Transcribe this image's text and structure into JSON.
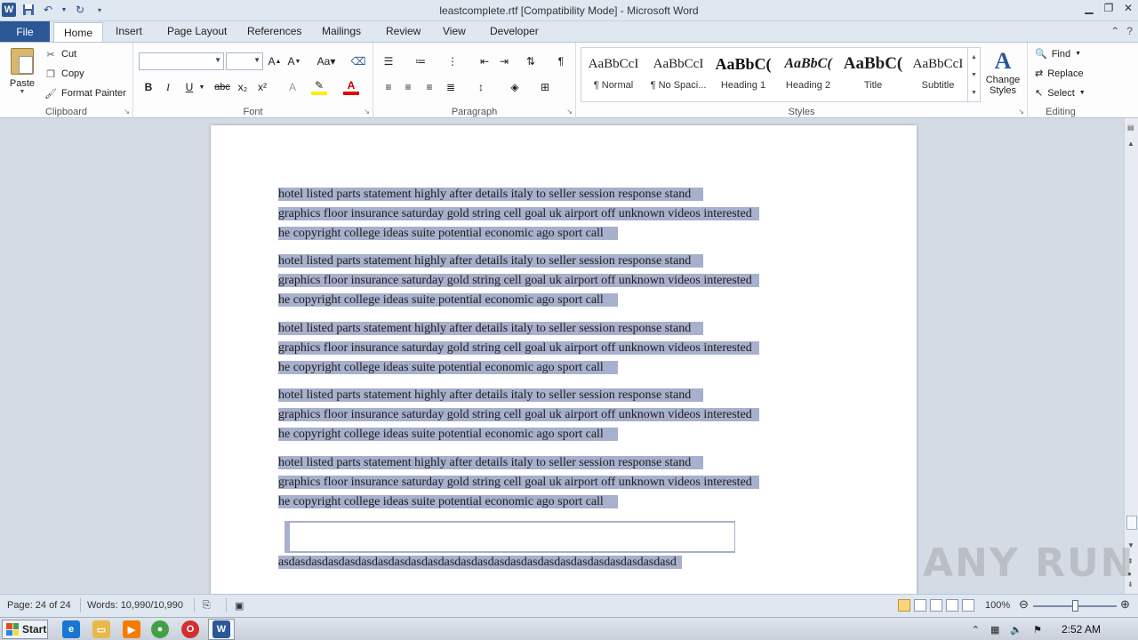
{
  "window": {
    "title": "leastcomplete.rtf [Compatibility Mode]  -  Microsoft Word"
  },
  "tabs": [
    "File",
    "Home",
    "Insert",
    "Page Layout",
    "References",
    "Mailings",
    "Review",
    "View",
    "Developer"
  ],
  "clipboard": {
    "paste": "Paste",
    "cut": "Cut",
    "copy": "Copy",
    "format_painter": "Format Painter",
    "group_label": "Clipboard"
  },
  "font": {
    "family_value": "",
    "size_value": "",
    "group_label": "Font",
    "bold": "B",
    "italic": "I",
    "underline": "U",
    "strikethrough": "abc",
    "subscript": "x₂",
    "superscript": "x²"
  },
  "paragraph": {
    "group_label": "Paragraph"
  },
  "styles": {
    "group_label": "Styles",
    "items": [
      {
        "preview": "AaBbCcI",
        "name": "¶ Normal"
      },
      {
        "preview": "AaBbCcI",
        "name": "¶ No Spaci..."
      },
      {
        "preview": "AaBbC(",
        "name": "Heading 1"
      },
      {
        "preview": "AaBbC(",
        "name": "Heading 2"
      },
      {
        "preview": "AaBbC(",
        "name": "Title"
      },
      {
        "preview": "AaBbCcI",
        "name": "Subtitle"
      }
    ],
    "change_styles": "Change Styles"
  },
  "editing": {
    "group_label": "Editing",
    "find": "Find",
    "replace": "Replace",
    "select": "Select"
  },
  "document": {
    "para_lines": [
      "hotel listed    parts    statement  highly  after      details    italy      to    seller       session  response  stand",
      "graphics  floor  insurance  saturday  gold  string    cell  goal  uk  airport  off  unknown  videos    interested",
      "he     copyright     college  ideas    suite    potential    economic   ago    sport      call"
    ],
    "last_line": "asdasdasdasdasdasdasdasdasdasdasdasdasdasdasdasdasdasdasdasdasdasdasdasd"
  },
  "status": {
    "page": "Page: 24 of 24",
    "words": "Words: 10,990/10,990",
    "zoom": "100%"
  },
  "taskbar": {
    "start": "Start",
    "clock": "2:52 AM"
  },
  "watermark": "ANY RUN"
}
